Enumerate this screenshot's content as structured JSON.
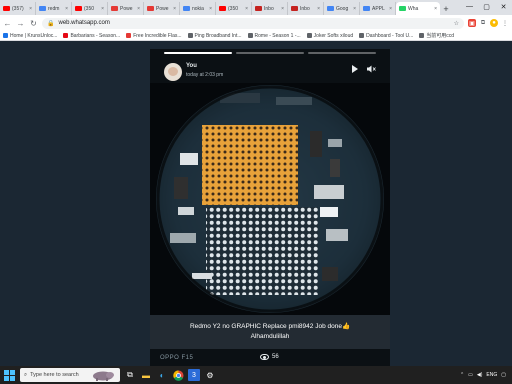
{
  "browser": {
    "tabs": [
      {
        "label": "(357)",
        "icon_color": "#ff0000"
      },
      {
        "label": "redm",
        "icon_color": "#4285f4"
      },
      {
        "label": "(350",
        "icon_color": "#ff0000"
      },
      {
        "label": "Powe",
        "icon_color": "#e53935"
      },
      {
        "label": "Powe",
        "icon_color": "#e53935"
      },
      {
        "label": "nokia",
        "icon_color": "#4285f4"
      },
      {
        "label": "(350",
        "icon_color": "#ff0000"
      },
      {
        "label": "Inbo",
        "icon_color": "#c5221f"
      },
      {
        "label": "Inbo",
        "icon_color": "#c5221f"
      },
      {
        "label": "Goog",
        "icon_color": "#4285f4"
      },
      {
        "label": "APPL",
        "icon_color": "#4285f4"
      },
      {
        "label": "Wha",
        "icon_color": "#25d366",
        "active": true
      }
    ],
    "new_tab_label": "+",
    "window_controls": {
      "minimize": "—",
      "maximize": "▢",
      "close": "✕"
    },
    "address": "web.whatsapp.com",
    "bookmarks": [
      {
        "label": "Home | KrunsUnloc...",
        "color": "#1a73e8"
      },
      {
        "label": "Barbarians - Season...",
        "color": "#e50914"
      },
      {
        "label": "Free Incredible Flas...",
        "color": "#e53935"
      },
      {
        "label": "Ping Broadband Int...",
        "color": "#5f6368"
      },
      {
        "label": "Rome - Season 1 -...",
        "color": "#5f6368"
      },
      {
        "label": "Joker Softs xiloud",
        "color": "#5f6368"
      },
      {
        "label": "Dashboard - Tool U...",
        "color": "#5f6368"
      },
      {
        "label": "当前可用ccd",
        "color": "#5f6368"
      }
    ]
  },
  "status": {
    "sender": "You",
    "time": "today at 2:03 pm",
    "progress_segments": [
      true,
      false,
      false
    ],
    "caption_line1": "Redmo Y2 no GRAPHIC Replace pmi8942 Job done👍",
    "caption_line2": "Alhamdulillah",
    "watermark": "OPPO F15",
    "views": "56",
    "icons": {
      "play": "play-icon",
      "mute": "mute-icon",
      "views": "eye-icon"
    }
  },
  "taskbar": {
    "search_placeholder": "Type here to search",
    "tray_text": "ENG"
  }
}
